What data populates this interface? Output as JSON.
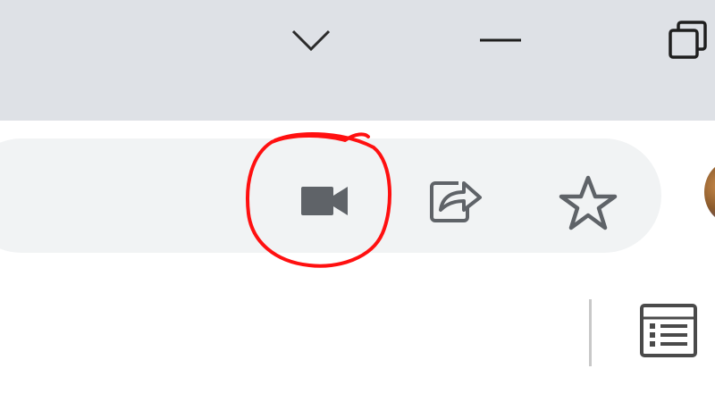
{
  "window": {
    "controls": {
      "tab_search_icon": "chevron-down-icon",
      "minimize_icon": "minimize-icon",
      "restore_icon": "restore-icon"
    },
    "titlebar_color": "#dee1e6"
  },
  "toolbar": {
    "omnibox_color": "#f1f3f4",
    "icons": [
      "video-camera-icon",
      "share-icon",
      "bookmark-star-icon"
    ],
    "profile_avatar": "avatar"
  },
  "annotation": {
    "shape": "freehand-circle",
    "color": "#ff0000",
    "target": "video-camera-icon"
  },
  "bookmarks_bar": {
    "icons": [
      "reading-list-icon"
    ]
  }
}
